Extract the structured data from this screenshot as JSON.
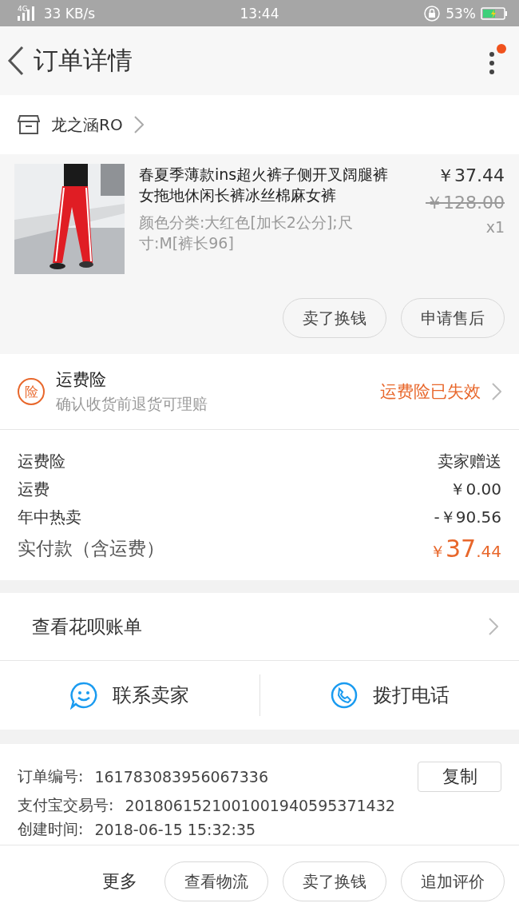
{
  "status_bar": {
    "network": "4G",
    "speed": "33 KB/s",
    "time": "13:44",
    "battery": "53%"
  },
  "header": {
    "title": "订单详情",
    "has_notification": true
  },
  "shop": {
    "name": "龙之涵RO"
  },
  "product": {
    "title": "春夏季薄款ins超火裤子侧开叉阔腿裤女拖地休闲长裤冰丝棉麻女裤",
    "sku": "颜色分类:大红色[加长2公分];尺寸:M[裤长96]",
    "price": "￥37.44",
    "original_price": "￥128.00",
    "quantity": "x1",
    "actions": [
      "卖了换钱",
      "申请售后"
    ]
  },
  "insurance": {
    "badge": "险",
    "title": "运费险",
    "subtitle": "确认收货前退货可理赔",
    "status": "运费险已失效"
  },
  "fees": [
    {
      "label": "运费险",
      "value": "卖家赠送"
    },
    {
      "label": "运费",
      "value": "￥0.00"
    },
    {
      "label": "年中热卖",
      "value": "-￥90.56"
    }
  ],
  "total": {
    "label": "实付款（含运费）",
    "currency": "￥",
    "integer": "37",
    "decimal": ".44"
  },
  "huabei": {
    "label": "查看花呗账单"
  },
  "contact": [
    {
      "kind": "chat",
      "label": "联系卖家"
    },
    {
      "kind": "phone",
      "label": "拨打电话"
    }
  ],
  "order_info": {
    "copy_button": "复制",
    "rows": [
      {
        "label": "订单编号:",
        "value": "161783083956067336"
      },
      {
        "label": "支付宝交易号:",
        "value": "2018061521001001940595371432"
      },
      {
        "label": "创建时间:",
        "value": "2018-06-15 15:32:35"
      }
    ]
  },
  "bottom_bar": {
    "more": "更多",
    "buttons": [
      "查看物流",
      "卖了换钱",
      "追加评价"
    ]
  }
}
